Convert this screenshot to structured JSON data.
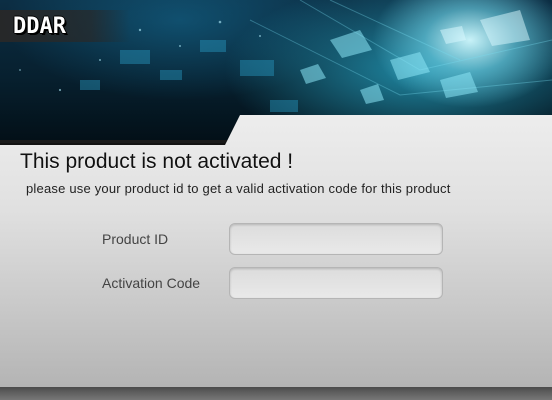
{
  "app": {
    "logo_text": "DDAR"
  },
  "message": {
    "title": "This product is not activated !",
    "subtitle": "please use your product id to get a valid activation code for this product"
  },
  "form": {
    "product_id": {
      "label": "Product ID",
      "value": "",
      "placeholder": ""
    },
    "activation_code": {
      "label": "Activation Code",
      "value": "",
      "placeholder": ""
    }
  },
  "colors": {
    "panel_top": "#ededed",
    "panel_bottom": "#b4b4b4",
    "banner_glow": "#78dcf0",
    "banner_dark": "#07202f"
  }
}
